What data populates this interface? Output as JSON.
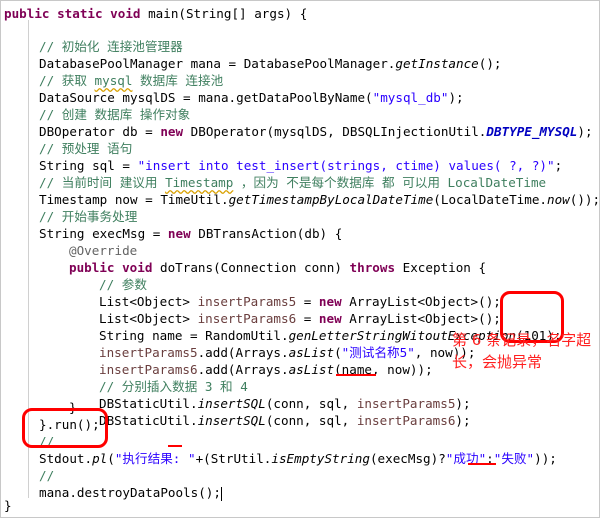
{
  "code": {
    "signature": {
      "kw": "public static void",
      "rest": " main(String[] args) {"
    },
    "c1": "// 初始化 连接池管理器",
    "l1": {
      "a": "DatabasePoolManager mana = DatabasePoolManager.",
      "m": "getInstance",
      "b": "();"
    },
    "c2": {
      "a": "// 获取 ",
      "u": "mysql",
      "b": " 数据库 连接池"
    },
    "l2": {
      "a": "DataSource mysqlDS = mana.getDataPoolByName(",
      "s": "\"mysql_db\"",
      "b": ");"
    },
    "c3": "// 创建 数据库 操作对象",
    "l3": {
      "a": "DBOperator db = ",
      "kw": "new",
      "b": " DBOperator(mysqlDS, DBSQLInjectionUtil.",
      "f": "DBTYPE_MYSQL",
      "c": ");"
    },
    "c4": "// 预处理 语句",
    "l4": {
      "a": "String sql = ",
      "s": "\"insert into test_insert(strings, ctime) values( ?, ?)\"",
      "b": ";"
    },
    "c5": {
      "a": "// 当前时间 建议用 ",
      "u": "Timestamp",
      "b": " ，因为 不是每个数据库 都 可以用 LocalDateTime"
    },
    "l5": {
      "a": "Timestamp now = TimeUtil.",
      "m": "getTimestampByLocalDateTime",
      "b": "(LocalDateTime.",
      "m2": "now",
      "c": "());"
    },
    "c6": "// 开始事务处理",
    "l6": {
      "a": "String execMsg = ",
      "kw": "new",
      "b": " DBTransAction(db) {"
    },
    "ann": "@Override",
    "l7": {
      "kw1": "public void",
      "a": " doTrans(Connection conn) ",
      "kw2": "throws",
      "b": " Exception {"
    },
    "c7": "// 参数",
    "l8": {
      "a": "List<Object> ",
      "v": "insertParams5",
      "b": " = ",
      "kw": "new",
      "c": " ArrayList<Object>();"
    },
    "l9": {
      "a": "List<Object> ",
      "v": "insertParams6",
      "b": " = ",
      "kw": "new",
      "c": " ArrayList<Object>();"
    },
    "l10": {
      "a": "String name = RandomUtil.",
      "m": "genLetterStringWitoutException",
      "b": "(101);"
    },
    "l11": {
      "v": "insertParams5",
      "a": ".add(Arrays.",
      "m": "asList",
      "b": "(",
      "s": "\"测试名称5\"",
      "c": ", now));"
    },
    "l12": {
      "v": "insertParams6",
      "a": ".add(Arrays.",
      "m": "asList",
      "b": "(name, now));"
    },
    "c8": "// 分别插入数据 3 和 4",
    "l13": {
      "a": "DBStaticUtil.",
      "m": "insertSQL",
      "b": "(conn, sql, ",
      "v": "insertParams5",
      "c": ");"
    },
    "l14": {
      "a": "DBStaticUtil.",
      "m": "insertSQL",
      "b": "(conn, sql, ",
      "v": "insertParams6",
      "c": ");"
    },
    "close1": "}",
    "close2": "}.run();",
    "c9": "//",
    "l15": {
      "a": "Stdout.",
      "m": "pl",
      "b": "(",
      "s1": "\"执行结果: \"",
      "c": "+(StrUtil.",
      "m2": "isEmptyString",
      "d": "(execMsg)?",
      "s2": "\"成功\"",
      "e": ":",
      "s3": "\"失败\"",
      "f": "));"
    },
    "c10": "//",
    "l16": "mana.destroyDataPools();",
    "close3": "}"
  },
  "annotation_note": "第 6 条记录，名字超长，会抛异常",
  "colors": {
    "keyword": "#7f0055",
    "comment": "#3f7f5f",
    "string": "#2a00ff",
    "field": "#0000c0",
    "highlight": "#ff0000"
  }
}
